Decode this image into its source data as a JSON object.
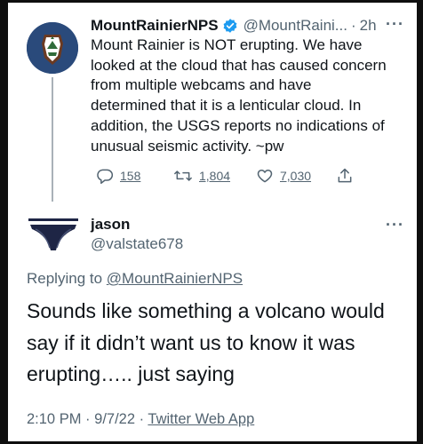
{
  "tweet": {
    "name": "MountRainierNPS",
    "handle": "@MountRaini...",
    "separator": "·",
    "time": "2h",
    "text": "Mount Rainier is NOT erupting. We have\nlooked at the cloud that has caused concern\nfrom multiple webcams and have\ndetermined that it is a lenticular cloud. In\naddition, the USGS reports no indications of\nunusual seismic activity. ~pw",
    "actions": {
      "replies": "158",
      "retweets": "1,804",
      "likes": "7,030"
    }
  },
  "reply": {
    "name": "jason",
    "handle": "@valstate678",
    "replying_prefix": "Replying to",
    "replying_to": "@MountRainierNPS",
    "text": "Sounds like something a volcano would say if it didn’t want us to know it was erupting….. just saying",
    "time": "2:10 PM",
    "date": "9/7/22",
    "separator": "·",
    "app": "Twitter Web App"
  },
  "icons": {
    "more": "more-icon",
    "verified": "verified-badge-icon",
    "reply": "reply-icon",
    "retweet": "retweet-icon",
    "like": "heart-icon",
    "share": "share-icon"
  },
  "colors": {
    "background": "#ffffff",
    "text": "#0f1419",
    "secondary": "#536471",
    "verified": "#1d9bf0",
    "avatar_bg": "#2a4a7b"
  }
}
